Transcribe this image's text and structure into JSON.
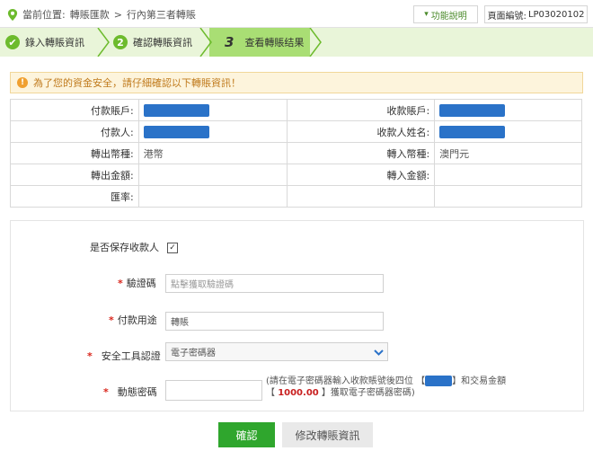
{
  "header": {
    "location_label": "當前位置:",
    "breadcrumb": [
      "轉賬匯款",
      "行內第三者轉賬"
    ],
    "breadcrumb_sep": ">",
    "help_label": "功能說明",
    "page_no_label": "頁面編號:",
    "page_no": "LP03020102"
  },
  "steps": [
    {
      "num": "✔",
      "label": "錄入轉賬資訊"
    },
    {
      "num": "2",
      "label": "確認轉賬資訊"
    },
    {
      "num": "3",
      "label": "查看轉賬结果"
    }
  ],
  "notice": "為了您的資金安全，請仔細確認以下轉賬資訊！",
  "info": {
    "payer_account_label": "付款賬戶:",
    "payee_account_label": "收款賬戶:",
    "payer_label": "付款人:",
    "payee_name_label": "收款人姓名:",
    "out_currency_label": "轉出幣種:",
    "out_currency": "港幣",
    "in_currency_label": "轉入幣種:",
    "in_currency": "澳門元",
    "out_amount_label": "轉出金額:",
    "out_amount": "",
    "in_amount_label": "轉入金額:",
    "in_amount": "",
    "rate_label": "匯率:",
    "rate": ""
  },
  "form": {
    "save_payee_label": "是否保存收款人",
    "save_payee_checked": true,
    "captcha_label": "驗證碼",
    "captcha_placeholder": "點擊獲取驗證碼",
    "purpose_label": "付款用途",
    "purpose_value": "轉賬",
    "security_tool_label": "安全工具認證",
    "security_tool_value": "電子密碼器",
    "dynamic_pwd_label": "動態密碼",
    "dynamic_pwd_value": "",
    "hint_part1": "(請在電子密碼器輸入收款賬號後四位",
    "hint_part2": "】和交易金額",
    "hint_part3": "【",
    "hint_amount": "1000.00",
    "hint_part4": "】獲取電子密碼器密碼)",
    "hint_bracket_open": "【"
  },
  "buttons": {
    "confirm": "確認",
    "modify": "修改轉賬資訊"
  },
  "colors": {
    "accent_green": "#2fa62d",
    "step_bg": "#e9f5d9",
    "step_active": "#a9de74",
    "mask_blue": "#2a72c8",
    "required_red": "#d9261c"
  }
}
